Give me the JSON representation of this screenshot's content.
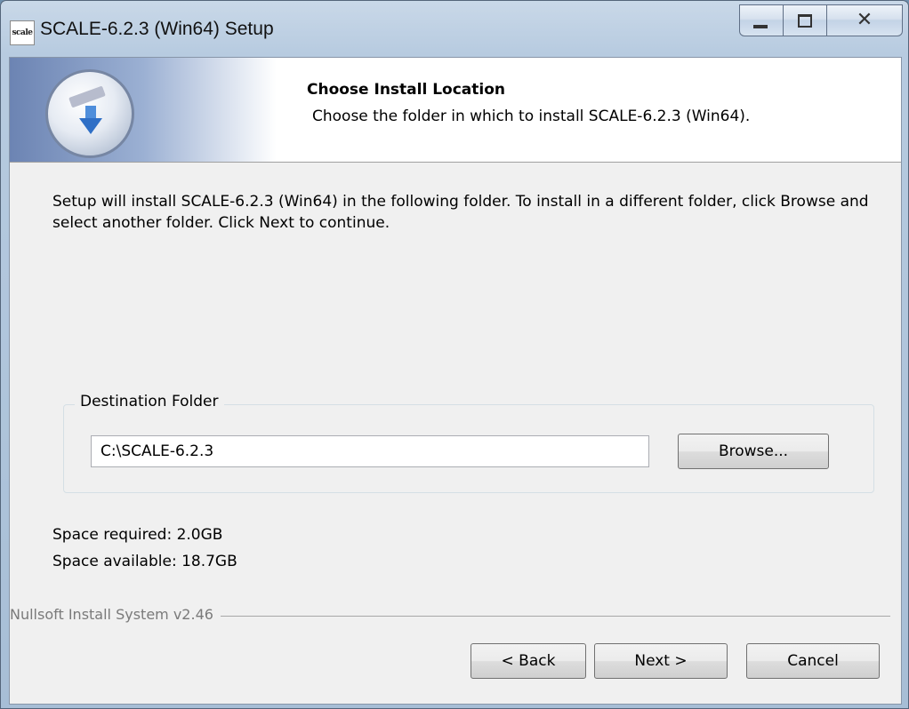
{
  "window": {
    "title": "SCALE-6.2.3 (Win64) Setup",
    "app_icon_text": "scale"
  },
  "header": {
    "title": "Choose Install Location",
    "subtitle": "Choose the folder in which to install SCALE-6.2.3 (Win64)."
  },
  "body": {
    "intro": "Setup will install SCALE-6.2.3 (Win64) in the following folder. To install in a different folder, click Browse and select another folder. Click Next to continue."
  },
  "destination": {
    "group_label": "Destination Folder",
    "path_value": "C:\\SCALE-6.2.3",
    "browse_label": "Browse..."
  },
  "space": {
    "required": "Space required: 2.0GB",
    "available": "Space available: 18.7GB"
  },
  "branding": "Nullsoft Install System v2.46",
  "buttons": {
    "back": "< Back",
    "next": "Next >",
    "cancel": "Cancel"
  },
  "icons": {
    "app": "scale-app-icon",
    "minimize": "minimize-icon",
    "maximize": "maximize-icon",
    "close": "close-icon",
    "header": "install-disc-icon"
  }
}
